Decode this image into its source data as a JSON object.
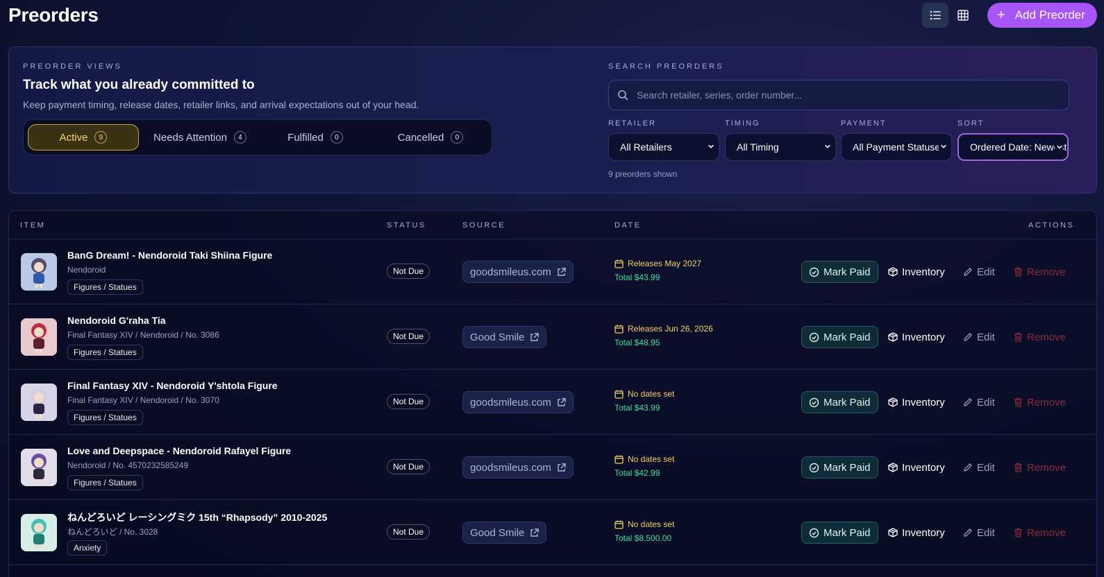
{
  "header": {
    "title": "Preorders",
    "add_label": "Add Preorder"
  },
  "views": {
    "eyebrow": "PREORDER VIEWS",
    "title": "Track what you already committed to",
    "description": "Keep payment timing, release dates, retailer links, and arrival expectations out of your head.",
    "tabs": [
      {
        "label": "Active",
        "count": "9"
      },
      {
        "label": "Needs Attention",
        "count": "4"
      },
      {
        "label": "Fulfilled",
        "count": "0"
      },
      {
        "label": "Cancelled",
        "count": "0"
      }
    ]
  },
  "search": {
    "eyebrow": "SEARCH PREORDERS",
    "placeholder": "Search retailer, series, order number...",
    "filters": [
      {
        "label": "RETAILER",
        "value": "All Retailers"
      },
      {
        "label": "TIMING",
        "value": "All Timing"
      },
      {
        "label": "PAYMENT",
        "value": "All Payment Statuses"
      },
      {
        "label": "SORT",
        "value": "Ordered Date: Newest"
      }
    ],
    "shown_text": "9 preorders shown"
  },
  "table": {
    "columns": {
      "item": "ITEM",
      "status": "STATUS",
      "source": "SOURCE",
      "date": "DATE",
      "actions": "ACTIONS"
    },
    "action_labels": {
      "paid": "Mark Paid",
      "inventory": "Inventory",
      "edit": "Edit",
      "remove": "Remove"
    },
    "rows": [
      {
        "name": "BanG Dream! - Nendoroid Taki Shiina Figure",
        "sub": "Nendoroid",
        "tag": "Figures / Statues",
        "status": "Not Due",
        "source": "goodsmileus.com",
        "date": "Releases May 2027",
        "total": "Total $43.99"
      },
      {
        "name": "Nendoroid G'raha Tia",
        "sub": "Final Fantasy XIV / Nendoroid / No. 3086",
        "tag": "Figures / Statues",
        "status": "Not Due",
        "source": "Good Smile",
        "date": "Releases Jun 26, 2026",
        "total": "Total $48.95"
      },
      {
        "name": "Final Fantasy XIV - Nendoroid Y'shtola Figure",
        "sub": "Final Fantasy XIV / Nendoroid / No. 3070",
        "tag": "Figures / Statues",
        "status": "Not Due",
        "source": "goodsmileus.com",
        "date": "No dates set",
        "total": "Total $43.99"
      },
      {
        "name": "Love and Deepspace - Nendoroid Rafayel Figure",
        "sub": "Nendoroid / No. 4570232585249",
        "tag": "Figures / Statues",
        "status": "Not Due",
        "source": "goodsmileus.com",
        "date": "No dates set",
        "total": "Total $42.99"
      },
      {
        "name": "ねんどろいど レーシングミク 15th “Rhapsody” 2010-2025",
        "sub": "ねんどろいど / No. 3028",
        "tag": "Anxiety",
        "status": "Not Due",
        "source": "Good Smile",
        "date": "No dates set",
        "total": "Total $8,500.00"
      }
    ]
  },
  "colors": {
    "accent": "#a855f7",
    "gold": "#f2cf66",
    "green": "#3ee0a0",
    "danger": "#8a2a3a"
  },
  "icons": [
    "list-icon",
    "grid-icon",
    "plus-icon",
    "search-icon",
    "chevron-down-icon",
    "external-link-icon",
    "calendar-icon",
    "check-circle-icon",
    "package-icon",
    "pencil-icon",
    "trash-icon"
  ]
}
